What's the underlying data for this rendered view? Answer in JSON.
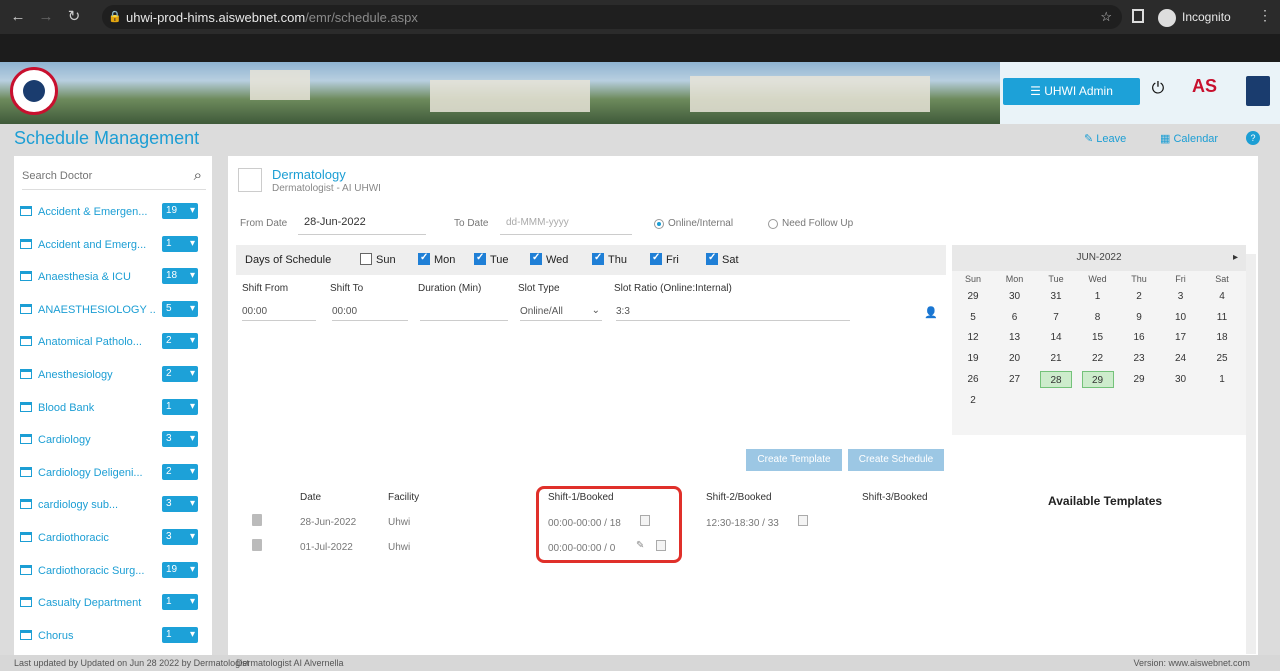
{
  "browser": {
    "url_host": "uhwi-prod-hims.aiswebnet.com",
    "url_path": "/emr/schedule.aspx",
    "incognito_label": "Incognito"
  },
  "header": {
    "admin_button": "UHWI Admin",
    "brand_text": "AS"
  },
  "page": {
    "title": "Schedule Management",
    "links": [
      "Leave",
      "Calendar"
    ]
  },
  "sidebar": {
    "search_placeholder": "Search Doctor",
    "items": [
      {
        "label": "Accident & Emergen...",
        "count": "19"
      },
      {
        "label": "Accident and Emerg...",
        "count": "1"
      },
      {
        "label": "Anaesthesia & ICU",
        "count": "18"
      },
      {
        "label": "ANAESTHESIOLOGY ...",
        "count": "5"
      },
      {
        "label": "Anatomical Patholo...",
        "count": "2"
      },
      {
        "label": "Anesthesiology",
        "count": "2"
      },
      {
        "label": "Blood Bank",
        "count": "1"
      },
      {
        "label": "Cardiology",
        "count": "3"
      },
      {
        "label": "Cardiology Deligeni...",
        "count": "2"
      },
      {
        "label": "cardiology sub...",
        "count": "3"
      },
      {
        "label": "Cardiothoracic",
        "count": "3"
      },
      {
        "label": "Cardiothoracic Surg...",
        "count": "19"
      },
      {
        "label": "Casualty Department",
        "count": "1"
      },
      {
        "label": "Chorus",
        "count": "1"
      }
    ]
  },
  "provider": {
    "name": "Dermatology",
    "sub": "Dermatologist - AI UHWI"
  },
  "form": {
    "from_label": "From Date",
    "from_value": "28-Jun-2022",
    "to_label": "To Date",
    "to_placeholder": "dd-MMM-yyyy",
    "radio_online": "Online/Internal",
    "radio_followup": "Need Follow Up"
  },
  "days": {
    "label": "Days of Schedule",
    "items": [
      {
        "label": "Sun",
        "checked": false
      },
      {
        "label": "Mon",
        "checked": true
      },
      {
        "label": "Tue",
        "checked": true
      },
      {
        "label": "Wed",
        "checked": true
      },
      {
        "label": "Thu",
        "checked": true
      },
      {
        "label": "Fri",
        "checked": true
      },
      {
        "label": "Sat",
        "checked": true
      }
    ]
  },
  "shift": {
    "headers": [
      "Shift From",
      "Shift To",
      "Duration (Min)",
      "Slot Type",
      "Slot Ratio (Online:Internal)"
    ],
    "from": "00:00",
    "to": "00:00",
    "duration": "",
    "slot_type": "Online/All",
    "ratio": "3:3"
  },
  "calendar": {
    "month": "JUN-2022",
    "day_headers": [
      "Sun",
      "Mon",
      "Tue",
      "Wed",
      "Thu",
      "Fri",
      "Sat"
    ],
    "weeks": [
      [
        "29",
        "30",
        "31",
        "1",
        "2",
        "3",
        "4"
      ],
      [
        "5",
        "6",
        "7",
        "8",
        "9",
        "10",
        "11"
      ],
      [
        "12",
        "13",
        "14",
        "15",
        "16",
        "17",
        "18"
      ],
      [
        "19",
        "20",
        "21",
        "22",
        "23",
        "24",
        "25"
      ],
      [
        "26",
        "27",
        "28",
        "29",
        "29",
        "30",
        "1"
      ],
      [
        "2",
        "",
        "",
        "",
        "",
        "",
        ""
      ]
    ],
    "selected": [
      "28",
      "29"
    ]
  },
  "buttons": {
    "template": "Create Template",
    "schedule": "Create Schedule"
  },
  "table": {
    "headers": [
      "Date",
      "Facility",
      "Shift-1/Booked",
      "Shift-2/Booked",
      "Shift-3/Booked"
    ],
    "rows": [
      {
        "date": "28-Jun-2022",
        "facility": "Uhwi",
        "shift1": "00:00-00:00 / 18",
        "shift2": "12:30-18:30 / 33"
      },
      {
        "date": "01-Jul-2022",
        "facility": "Uhwi",
        "shift1": "00:00-00:00 / 0",
        "shift2": ""
      }
    ]
  },
  "templates_title": "Available Templates",
  "footer": {
    "left": "Last updated by Updated on Jun 28 2022 by Dermatologist",
    "mid": "Dermatologist AI Alvernella",
    "right": "Version: www.aiswebnet.com"
  }
}
